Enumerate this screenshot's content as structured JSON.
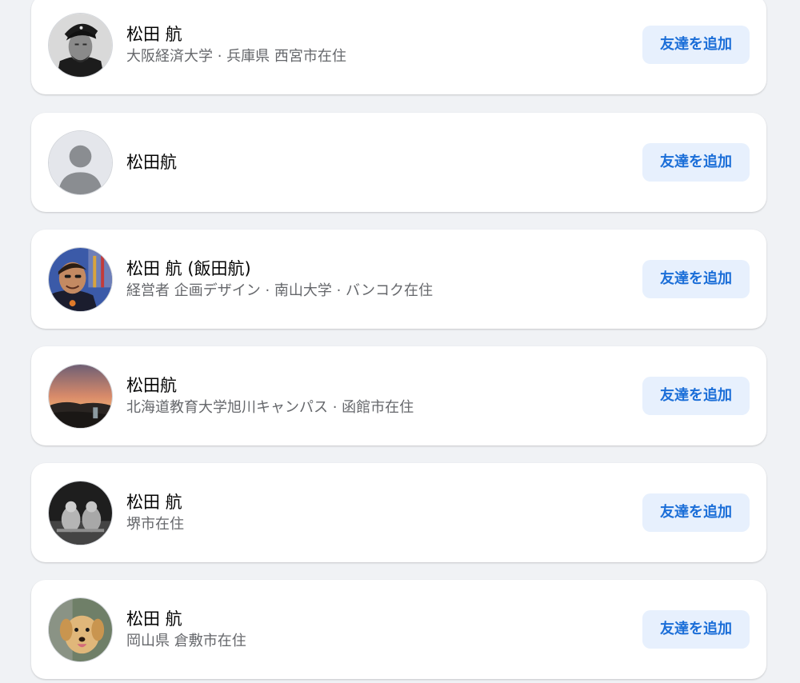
{
  "results": [
    {
      "name": "松田 航",
      "subtitle": "大阪経済大学 · 兵庫県 西宮市在住",
      "button_label": "友達を追加",
      "avatar_icon": "bw-portrait-photo"
    },
    {
      "name": "松田航",
      "subtitle": "",
      "button_label": "友達を追加",
      "avatar_icon": "default-user-silhouette"
    },
    {
      "name": "松田 航 (飯田航)",
      "subtitle": "経営者 企画デザイン · 南山大学 · バンコク在住",
      "button_label": "友達を追加",
      "avatar_icon": "selfie-photo"
    },
    {
      "name": "松田航",
      "subtitle": "北海道教育大学旭川キャンパス · 函館市在住",
      "button_label": "友達を追加",
      "avatar_icon": "sunset-photo"
    },
    {
      "name": "松田 航",
      "subtitle": "堺市在住",
      "button_label": "友達を追加",
      "avatar_icon": "bw-sculpture-photo"
    },
    {
      "name": "松田 航",
      "subtitle": "岡山県 倉敷市在住",
      "button_label": "友達を追加",
      "avatar_icon": "puppy-photo"
    }
  ],
  "colors": {
    "background": "#f0f2f5",
    "card": "#ffffff",
    "button_bg": "#e7f0fd",
    "button_text": "#1b6ed8",
    "name_text": "#050505",
    "subtitle_text": "#65676b"
  }
}
